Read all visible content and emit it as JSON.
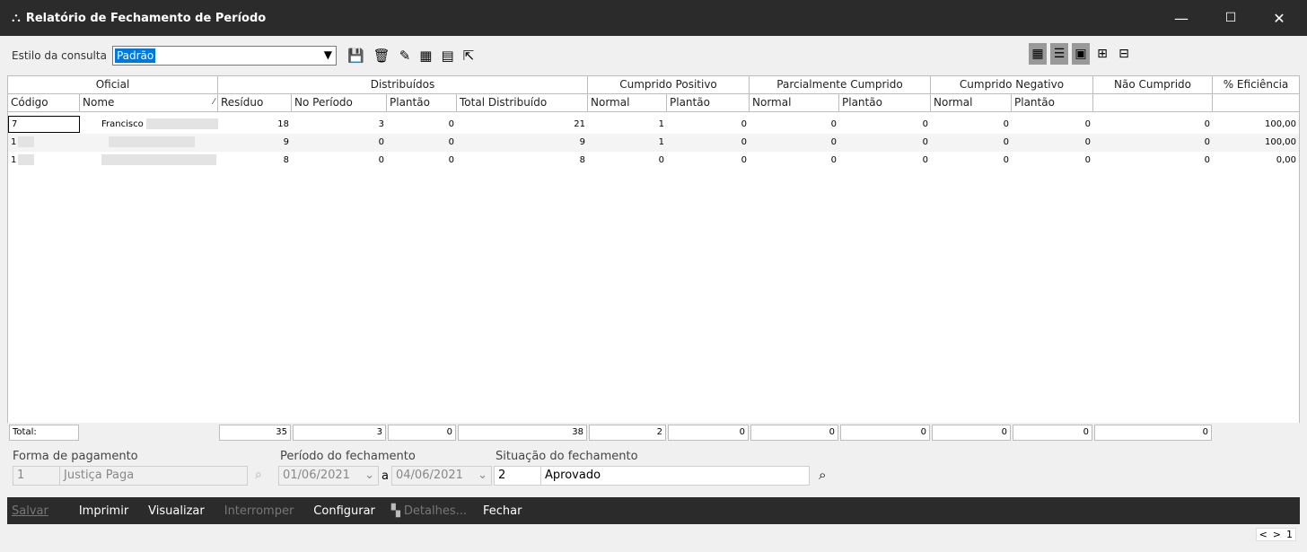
{
  "window": {
    "title": "Relatório de Fechamento de Período",
    "minimize": "—",
    "maximize": "☐",
    "close": "✕"
  },
  "toolbar": {
    "style_label": "Estilo da consulta",
    "style_value": "Padrão"
  },
  "table": {
    "groups": [
      "Oficial",
      "Distribuídos",
      "Cumprido Positivo",
      "Parcialmente Cumprido",
      "Cumprido Negativo",
      "Não Cumprido",
      "% Eficiência"
    ],
    "columns": [
      "Código",
      "Nome",
      "Resíduo",
      "No Período",
      "Plantão",
      "Total Distribuído",
      "Normal",
      "Plantão",
      "Normal",
      "Plantão",
      "Normal",
      "Plantão",
      "",
      ""
    ],
    "rows": [
      {
        "codigo": "7",
        "nome": "Francisco",
        "residuo": "18",
        "periodo": "3",
        "plantao": "0",
        "total": "21",
        "cp_normal": "1",
        "cp_plantao": "0",
        "pc_normal": "0",
        "pc_plantao": "0",
        "cn_normal": "0",
        "cn_plantao": "0",
        "nao": "0",
        "efic": "100,00"
      },
      {
        "codigo": "1",
        "nome": "",
        "residuo": "9",
        "periodo": "0",
        "plantao": "0",
        "total": "9",
        "cp_normal": "1",
        "cp_plantao": "0",
        "pc_normal": "0",
        "pc_plantao": "0",
        "cn_normal": "0",
        "cn_plantao": "0",
        "nao": "0",
        "efic": "100,00"
      },
      {
        "codigo": "1",
        "nome": "",
        "residuo": "8",
        "periodo": "0",
        "plantao": "0",
        "total": "8",
        "cp_normal": "0",
        "cp_plantao": "0",
        "pc_normal": "0",
        "pc_plantao": "0",
        "cn_normal": "0",
        "cn_plantao": "0",
        "nao": "0",
        "efic": "0,00"
      }
    ],
    "totals": {
      "label": "Total:",
      "residuo": "35",
      "periodo": "3",
      "plantao": "0",
      "total": "38",
      "cp_normal": "2",
      "cp_plantao": "0",
      "pc_normal": "0",
      "pc_plantao": "0",
      "cn_normal": "0",
      "cn_plantao": "0",
      "nao": "0"
    }
  },
  "filters": {
    "pagamento_label": "Forma de pagamento",
    "pagamento_code": "1",
    "pagamento_value": "Justiça Paga",
    "periodo_label": "Período do fechamento",
    "periodo_from": "01/06/2021",
    "periodo_sep": "a",
    "periodo_to": "04/06/2021",
    "situacao_label": "Situação do fechamento",
    "situacao_code": "2",
    "situacao_value": "Aprovado"
  },
  "actions": {
    "salvar": "Salvar",
    "imprimir": "Imprimir",
    "visualizar": "Visualizar",
    "interromper": "Interromper",
    "configurar": "Configurar",
    "detalhes": "Detalhes...",
    "fechar": "Fechar"
  },
  "pager": {
    "prev": "<",
    "next": ">",
    "page": "1"
  },
  "colors": {
    "accent": "#0078d7",
    "titlebar": "#2b2b2b"
  }
}
